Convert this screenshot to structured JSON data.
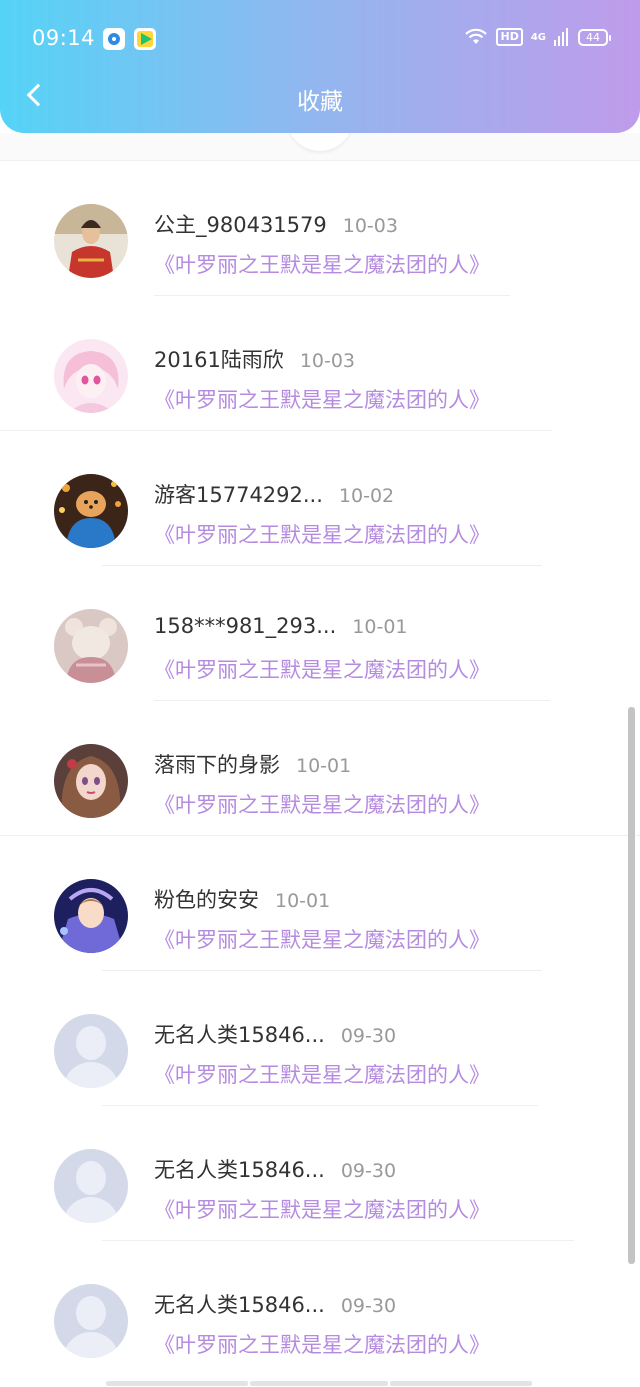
{
  "status_bar": {
    "time": "09:14",
    "hd_label": "HD",
    "net_label": "4G",
    "battery": "44"
  },
  "header": {
    "title": "收藏"
  },
  "items": [
    {
      "name": "公主_980431579",
      "date": "10-03",
      "book": "《叶罗丽之王默是星之魔法团的人》",
      "avatar": "photo"
    },
    {
      "name": "20161陆雨欣",
      "date": "10-03",
      "book": "《叶罗丽之王默是星之魔法团的人》",
      "avatar": "anime-pink"
    },
    {
      "name": "游客15774292...",
      "date": "10-02",
      "book": "《叶罗丽之王默是星之魔法团的人》",
      "avatar": "dog"
    },
    {
      "name": "158***981_293...",
      "date": "10-01",
      "book": "《叶罗丽之王默是星之魔法团的人》",
      "avatar": "plush"
    },
    {
      "name": "落雨下的身影",
      "date": "10-01",
      "book": "《叶罗丽之王默是星之魔法团的人》",
      "avatar": "anime-girl"
    },
    {
      "name": "粉色的安安",
      "date": "10-01",
      "book": "《叶罗丽之王默是星之魔法团的人》",
      "avatar": "anime-blue"
    },
    {
      "name": "无名人类15846...",
      "date": "09-30",
      "book": "《叶罗丽之王默是星之魔法团的人》",
      "avatar": "default"
    },
    {
      "name": "无名人类15846...",
      "date": "09-30",
      "book": "《叶罗丽之王默是星之魔法团的人》",
      "avatar": "default"
    },
    {
      "name": "无名人类15846...",
      "date": "09-30",
      "book": "《叶罗丽之王默是星之魔法团的人》",
      "avatar": "default"
    }
  ],
  "colors": {
    "header_gradient": [
      "#55d3f6",
      "#93b6ef",
      "#bf9ceb"
    ],
    "book_title": "#b58be0",
    "username": "#333333",
    "date": "#999999"
  }
}
